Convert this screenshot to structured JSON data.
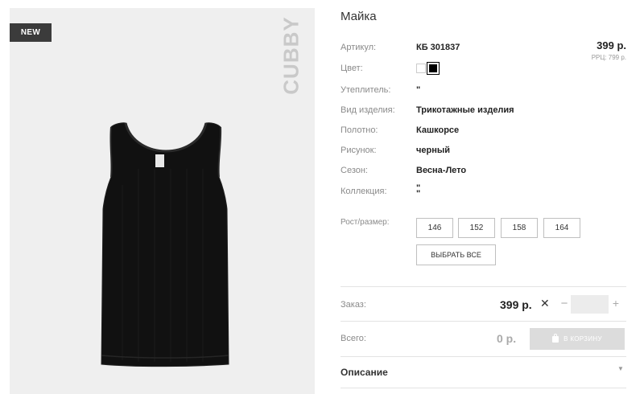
{
  "gallery": {
    "badge": "NEW",
    "brand": "CUBBY"
  },
  "product": {
    "title": "Майка",
    "price": "399 р.",
    "rrc": "РРЦ: 799 р.",
    "specs": [
      {
        "label": "Артикул:",
        "value": "КБ 301837"
      },
      {
        "label": "Цвет:",
        "value": ""
      },
      {
        "label": "Утеплитель:",
        "value": "\""
      },
      {
        "label": "Вид изделия:",
        "value": "Трикотажные изделия"
      },
      {
        "label": "Полотно:",
        "value": "Кашкорсе"
      },
      {
        "label": "Рисунок:",
        "value": "черный"
      },
      {
        "label": "Сезон:",
        "value": "Весна-Лето"
      },
      {
        "label": "Коллекция:",
        "value": "\"\n\""
      }
    ],
    "colors": [
      "#ffffff",
      "#000000"
    ],
    "sizes_label": "Рост/размер:",
    "sizes": [
      "146",
      "152",
      "158",
      "164"
    ],
    "select_all": "ВЫБРАТЬ ВСЕ"
  },
  "order": {
    "label": "Заказ:",
    "price": "399 р.",
    "times": "✕",
    "minus": "−",
    "plus": "+",
    "quantity": ""
  },
  "total": {
    "label": "Всего:",
    "value": "0 р.",
    "cart_button": "В КОРЗИНУ"
  },
  "description": {
    "label": "Описание",
    "chevron": "▼"
  }
}
